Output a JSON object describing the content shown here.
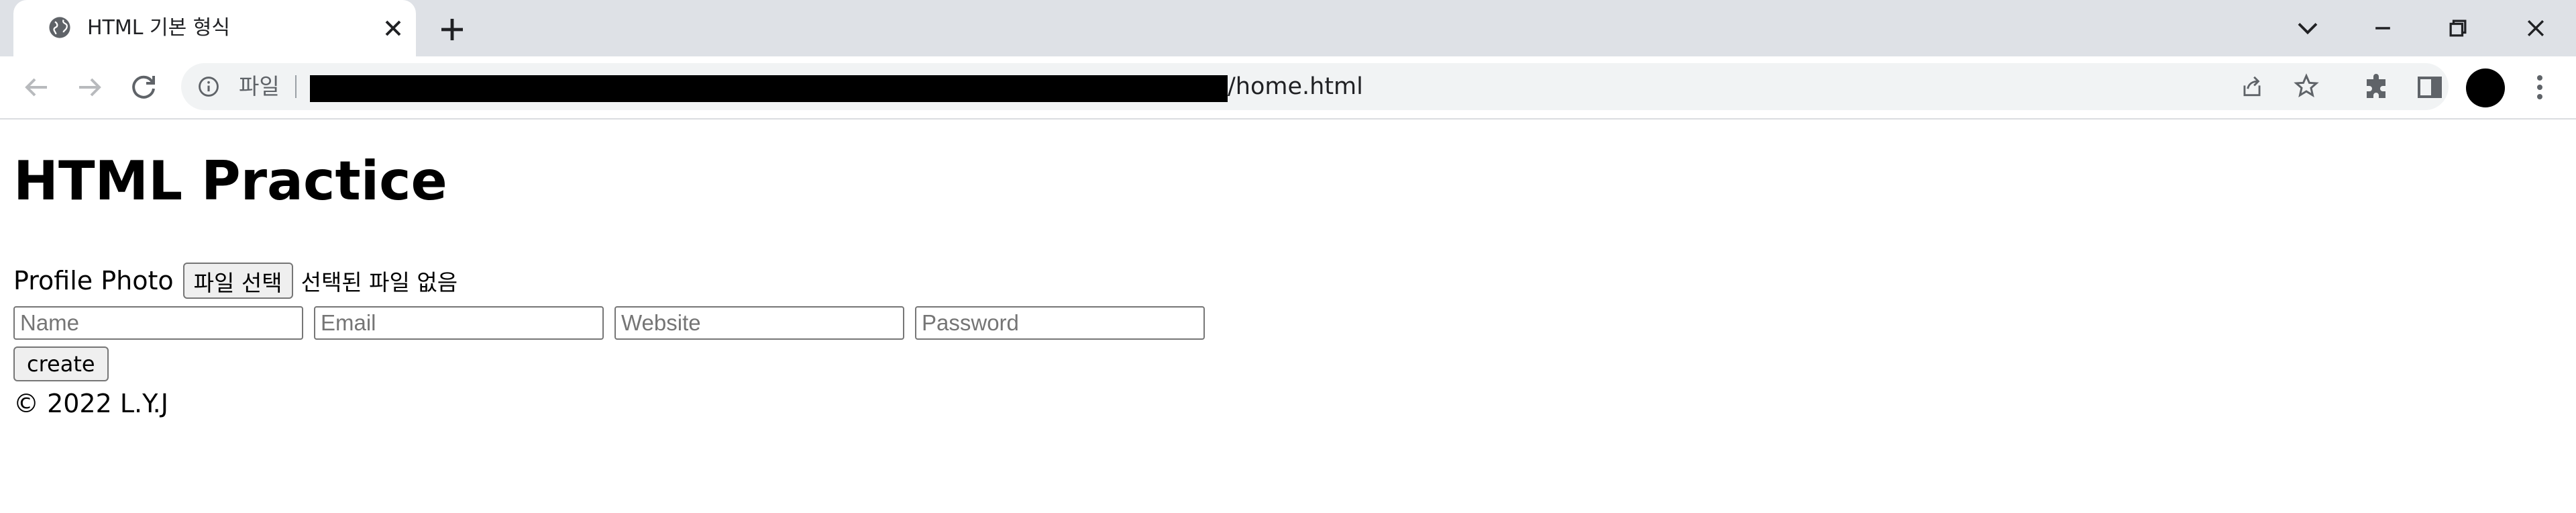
{
  "browser": {
    "tab": {
      "title": "HTML 기본 형식"
    },
    "omnibox": {
      "scheme_label": "파일",
      "url_suffix": "/home.html"
    }
  },
  "page": {
    "heading": "HTML Practice",
    "profile_photo_label": "Profile Photo",
    "file_button_label": "파일 선택",
    "file_status": "선택된 파일 없음",
    "inputs": [
      {
        "placeholder": "Name"
      },
      {
        "placeholder": "Email"
      },
      {
        "placeholder": "Website"
      },
      {
        "placeholder": "Password"
      }
    ],
    "create_label": "create",
    "footer": "© 2022 L.Y.J"
  },
  "colors": {
    "tabstrip": "#dee1e6",
    "omnibox": "#f1f3f4",
    "icon": "#5f6368"
  }
}
